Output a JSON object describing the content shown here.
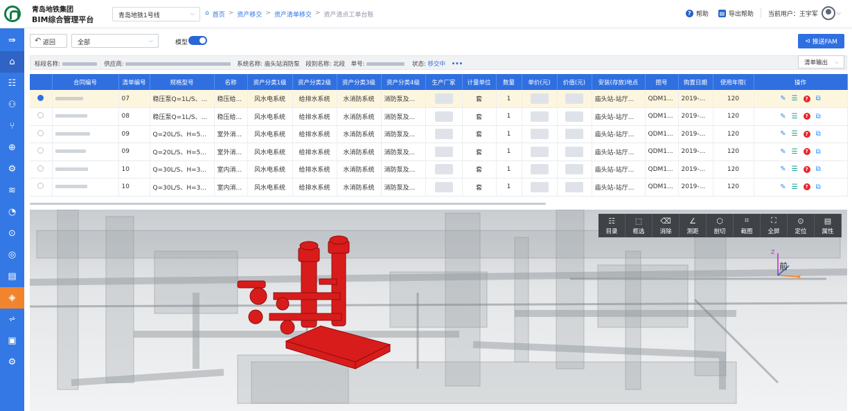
{
  "brand": {
    "line1": "青岛地铁集团",
    "line2": "BIM综合管理平台"
  },
  "header": {
    "line_select": "青岛地铁1号线",
    "breadcrumbs": [
      {
        "label": "首页",
        "link": true
      },
      {
        "label": "资产移交",
        "link": true
      },
      {
        "label": "资产清单移交",
        "link": true
      },
      {
        "label": "资产清点工单台账",
        "link": false
      }
    ],
    "help": "帮助",
    "export_help": "导出帮助",
    "current_user": "当前用户：王宇军"
  },
  "sidebar": {
    "items": [
      {
        "icon": "menu-toggle-icon",
        "glyph": "⇛"
      },
      {
        "icon": "home-icon",
        "glyph": "⌂"
      },
      {
        "icon": "structure-icon",
        "glyph": "☷"
      },
      {
        "icon": "nodes-icon",
        "glyph": "⚇"
      },
      {
        "icon": "branch-icon",
        "glyph": "⑂"
      },
      {
        "icon": "monitor-icon",
        "glyph": "⊕"
      },
      {
        "icon": "gear-node-icon",
        "glyph": "⚙"
      },
      {
        "icon": "sliders-icon",
        "glyph": "≋"
      },
      {
        "icon": "chart-pie-icon",
        "glyph": "◔"
      },
      {
        "icon": "shield-icon",
        "glyph": "⊙"
      },
      {
        "icon": "target-icon",
        "glyph": "◎"
      },
      {
        "icon": "document-icon",
        "glyph": "▤"
      },
      {
        "icon": "asset-icon",
        "glyph": "◈"
      },
      {
        "icon": "line-chart-icon",
        "glyph": "⩫"
      },
      {
        "icon": "card-icon",
        "glyph": "▣"
      },
      {
        "icon": "settings-icon",
        "glyph": "⚙"
      }
    ]
  },
  "toolbar": {
    "back": "返回",
    "filter": "全部",
    "model_label": "模型",
    "model_on": true,
    "push_btn": "推送FAM"
  },
  "info": {
    "bid_label": "标段名称:",
    "supplier_label": "供应商:",
    "system_label": "系统名称:",
    "system_value": "庙头站消防泵",
    "section_label": "段别名称:",
    "section_value": "北段",
    "order_label": "单号:",
    "status_label": "状态:",
    "status_value": "移交中",
    "more": "•••",
    "export_btn": "清单输出"
  },
  "table": {
    "headers": [
      "",
      "合同编号",
      "清单编号",
      "规格型号",
      "名称",
      "资产分类1级",
      "资产分类2级",
      "资产分类3级",
      "资产分类4级",
      "生产厂家",
      "计量单位",
      "数量",
      "单价(元)",
      "价值(元)",
      "安装(存放)地点",
      "图号",
      "购置日期",
      "使用年限(",
      "操作"
    ],
    "rows": [
      {
        "selected": true,
        "list_no": "07",
        "spec": "稳压泵Q=1L/S、...",
        "name": "稳压给...",
        "c1": "风水电系统",
        "c2": "给排水系统",
        "c3": "水消防系统",
        "c4": "消防泵及...",
        "unit": "套",
        "qty": "1",
        "loc": "庙头站-站厅...",
        "drawing": "QDM1...",
        "date": "2019-...",
        "life": "120"
      },
      {
        "selected": false,
        "list_no": "08",
        "spec": "稳压泵Q=1L/S、...",
        "name": "稳压给...",
        "c1": "风水电系统",
        "c2": "给排水系统",
        "c3": "水消防系统",
        "c4": "消防泵及...",
        "unit": "套",
        "qty": "1",
        "loc": "庙头站-站厅...",
        "drawing": "QDM1...",
        "date": "2019-...",
        "life": "120"
      },
      {
        "selected": false,
        "list_no": "09",
        "spec": "Q=20L/S、H=5...",
        "name": "室外消...",
        "c1": "风水电系统",
        "c2": "给排水系统",
        "c3": "水消防系统",
        "c4": "消防泵及...",
        "unit": "套",
        "qty": "1",
        "loc": "庙头站-站厅...",
        "drawing": "QDM1...",
        "date": "2019-...",
        "life": "120"
      },
      {
        "selected": false,
        "list_no": "09",
        "spec": "Q=20L/S、H=5...",
        "name": "室外消...",
        "c1": "风水电系统",
        "c2": "给排水系统",
        "c3": "水消防系统",
        "c4": "消防泵及...",
        "unit": "套",
        "qty": "1",
        "loc": "庙头站-站厅...",
        "drawing": "QDM1...",
        "date": "2019-...",
        "life": "120"
      },
      {
        "selected": false,
        "list_no": "10",
        "spec": "Q=30L/S、H=3...",
        "name": "室内消...",
        "c1": "风水电系统",
        "c2": "给排水系统",
        "c3": "水消防系统",
        "c4": "消防泵及...",
        "unit": "套",
        "qty": "1",
        "loc": "庙头站-站厅...",
        "drawing": "QDM1...",
        "date": "2019-...",
        "life": "120"
      },
      {
        "selected": false,
        "list_no": "10",
        "spec": "Q=30L/S、H=3...",
        "name": "室内消...",
        "c1": "风水电系统",
        "c2": "给排水系统",
        "c3": "水消防系统",
        "c4": "消防泵及...",
        "unit": "套",
        "qty": "1",
        "loc": "庙头站-站厅...",
        "drawing": "QDM1...",
        "date": "2019-...",
        "life": "120"
      }
    ]
  },
  "viewer": {
    "tools": [
      {
        "label": "目录",
        "icon": "catalog-icon",
        "glyph": "☷"
      },
      {
        "label": "框选",
        "icon": "box-select-icon",
        "glyph": "⬚"
      },
      {
        "label": "消除",
        "icon": "erase-icon",
        "glyph": "⌫"
      },
      {
        "label": "测距",
        "icon": "measure-icon",
        "glyph": "∠"
      },
      {
        "label": "剖切",
        "icon": "section-cut-icon",
        "glyph": "⬡"
      },
      {
        "label": "截图",
        "icon": "screenshot-icon",
        "glyph": "⌗"
      },
      {
        "label": "全屏",
        "icon": "fullscreen-icon",
        "glyph": "⛶"
      },
      {
        "label": "定位",
        "icon": "locate-icon",
        "glyph": "⊙"
      },
      {
        "label": "属性",
        "icon": "properties-icon",
        "glyph": "▤"
      }
    ],
    "view_cube": {
      "face": "前",
      "z_axis": "Z",
      "x_axis": "X"
    }
  },
  "colors": {
    "primary": "#2f6fe0",
    "sidebar": "#3378e4",
    "sidebar_active": "#f1842c",
    "pump": "#d81c1c",
    "selected_row": "#fdf6df"
  }
}
